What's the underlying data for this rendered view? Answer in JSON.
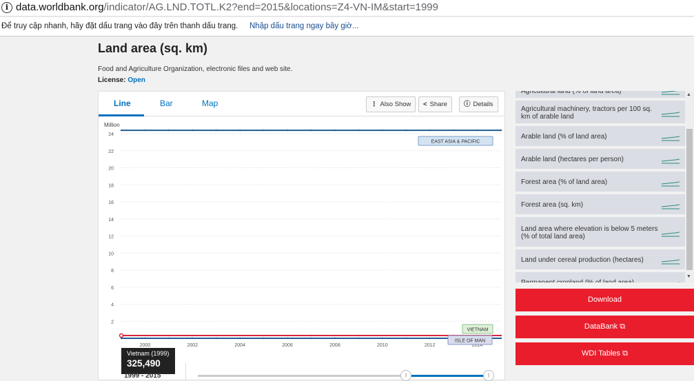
{
  "browser": {
    "url_host": "data.worldbank.org",
    "url_path": "/indicator/AG.LND.TOTL.K2?end=2015&locations=Z4-VN-IM&start=1999",
    "bookmark_prompt": "Để truy cập nhanh, hãy đặt dấu trang vào đây trên thanh dấu trang.",
    "bookmark_link": "Nhập dấu trang ngay bây giờ..."
  },
  "page": {
    "title": "Land area (sq. km)",
    "source": "Food and Agriculture Organization, electronic files and web site.",
    "license_label": "License:",
    "license_value": "Open"
  },
  "tabs": [
    {
      "label": "Line",
      "active": true
    },
    {
      "label": "Bar",
      "active": false
    },
    {
      "label": "Map",
      "active": false
    }
  ],
  "toolbar": {
    "also_show": "Also Show",
    "share": "Share",
    "details": "Details"
  },
  "chart_data": {
    "type": "line",
    "ylabel": "Million",
    "ylim": [
      0,
      24
    ],
    "yticks": [
      2,
      4,
      6,
      8,
      10,
      12,
      14,
      16,
      18,
      20,
      22,
      24
    ],
    "xlim": [
      1999,
      2015
    ],
    "xticks": [
      2000,
      2002,
      2004,
      2006,
      2008,
      2010,
      2012,
      2014
    ],
    "series": [
      {
        "name": "EAST ASIA & PACIFIC",
        "color": "#1f5b93",
        "label_bg": "#d4e3f2",
        "label_border": "#7aa2c9",
        "x": [
          1999,
          2000,
          2001,
          2002,
          2003,
          2004,
          2005,
          2006,
          2007,
          2008,
          2009,
          2010,
          2011,
          2012,
          2013,
          2014,
          2015
        ],
        "values": [
          24.4,
          24.4,
          24.4,
          24.4,
          24.4,
          24.4,
          24.4,
          24.4,
          24.4,
          24.4,
          24.4,
          24.4,
          24.4,
          24.4,
          24.4,
          24.4,
          24.4
        ]
      },
      {
        "name": "VIETNAM",
        "color": "#d9263b",
        "label_bg": "#dff0d8",
        "label_border": "#8fc18f",
        "x": [
          1999,
          2000,
          2001,
          2002,
          2003,
          2004,
          2005,
          2006,
          2007,
          2008,
          2009,
          2010,
          2011,
          2012,
          2013,
          2014,
          2015
        ],
        "values": [
          0.325,
          0.325,
          0.325,
          0.325,
          0.325,
          0.325,
          0.325,
          0.325,
          0.325,
          0.325,
          0.325,
          0.325,
          0.325,
          0.325,
          0.325,
          0.325,
          0.325
        ]
      },
      {
        "name": "ISLE OF MAN",
        "color": "#1f5b93",
        "label_bg": "#d9dced",
        "label_border": "#8f96c8",
        "x": [
          1999,
          2000,
          2001,
          2002,
          2003,
          2004,
          2005,
          2006,
          2007,
          2008,
          2009,
          2010,
          2011,
          2012,
          2013,
          2014,
          2015
        ],
        "values": [
          0.0006,
          0.0006,
          0.0006,
          0.0006,
          0.0006,
          0.0006,
          0.0006,
          0.0006,
          0.0006,
          0.0006,
          0.0006,
          0.0006,
          0.0006,
          0.0006,
          0.0006,
          0.0006,
          0.0006
        ]
      }
    ]
  },
  "tooltip": {
    "label": "Vietnam (1999)",
    "value": "325,490"
  },
  "range": {
    "label": "1999 - 2015"
  },
  "related": [
    {
      "label": "Agricultural land (% of land area)"
    },
    {
      "label": "Agricultural machinery, tractors per 100 sq. km of arable land"
    },
    {
      "label": "Arable land (% of land area)"
    },
    {
      "label": "Arable land (hectares per person)"
    },
    {
      "label": "Forest area (% of land area)"
    },
    {
      "label": "Forest area (sq. km)"
    },
    {
      "label": "Land area where elevation is below 5 meters (% of total land area)"
    },
    {
      "label": "Land under cereal production (hectares)"
    },
    {
      "label": "Permanent cropland (% of land area)"
    }
  ],
  "actions": {
    "download": "Download",
    "databank": "DataBank",
    "wdi": "WDI Tables"
  },
  "colors": {
    "accent": "#0071bc",
    "red": "#ea1d2c"
  }
}
